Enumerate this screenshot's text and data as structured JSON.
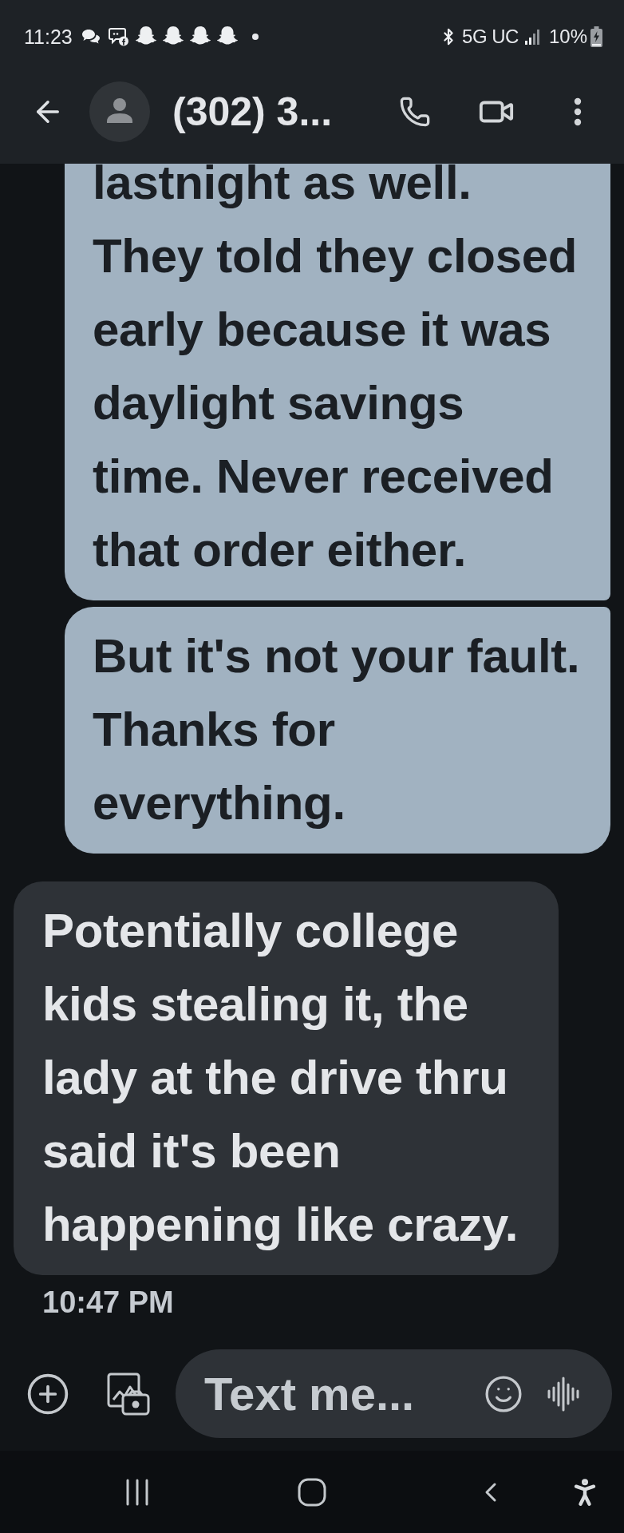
{
  "status_bar": {
    "time": "11:23",
    "network": "5G UC",
    "battery": "10%"
  },
  "header": {
    "title": "(302) 3..."
  },
  "messages": [
    {
      "kind": "sent",
      "lines": [
        "lastnight as well.",
        "They told they closed",
        "early because it was",
        "daylight savings",
        "time. Never received",
        "that order either."
      ]
    },
    {
      "kind": "sent",
      "lines": [
        "But it's not your fault.",
        "Thanks for",
        "everything."
      ]
    },
    {
      "kind": "received",
      "lines": [
        "Potentially college",
        "kids stealing it, the",
        "lady at the drive thru",
        "said it's been",
        "happening like crazy."
      ]
    }
  ],
  "timestamp": "10:47 PM",
  "composer": {
    "placeholder": "Text me..."
  }
}
